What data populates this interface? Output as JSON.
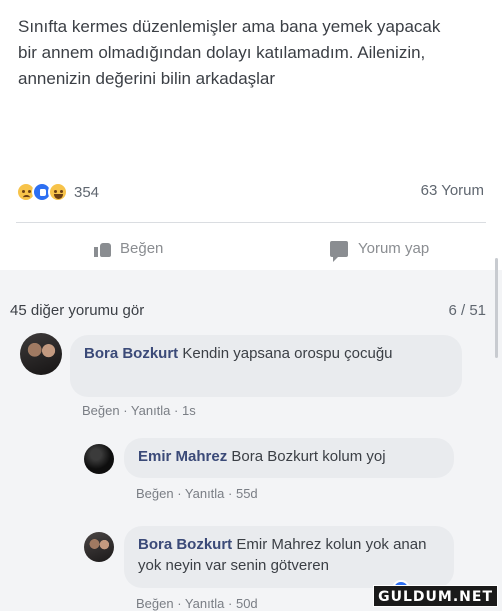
{
  "post": {
    "text": "Sınıfta kermes düzenlemişler ama bana yemek yapacak bir annem olmadığından dolayı katılamadım. Ailenizin, annenizin değerini bilin arkadaşlar",
    "reactions": {
      "icons": [
        "sad-icon",
        "like-icon",
        "haha-icon"
      ],
      "count": "354"
    },
    "comment_count": "63 Yorum"
  },
  "actions": {
    "like_label": "Beğen",
    "comment_label": "Yorum yap"
  },
  "comments_section": {
    "more_comments": "45 diğer yorumu gör",
    "pager": "6 / 51"
  },
  "comments": [
    {
      "author": "Bora Bozkurt",
      "text": "Kendin yapsana orospu çocuğu",
      "meta": "Beğen · Yanıtla · 1s"
    },
    {
      "author": "Emir Mahrez",
      "text": "Bora Bozkurt kolum yoj",
      "meta": "Beğen · Yanıtla · 55d"
    },
    {
      "author": "Bora Bozkurt",
      "text": "Emir Mahrez kolun yok anan yok neyin var senin götveren",
      "meta": "Beğen · Yanıtla · 50d"
    }
  ],
  "watermark": "GULDUM.NET",
  "colors": {
    "name_link": "#3b4a78",
    "bubble": "#e9ebee",
    "like_blue": "#2d6ff2"
  }
}
